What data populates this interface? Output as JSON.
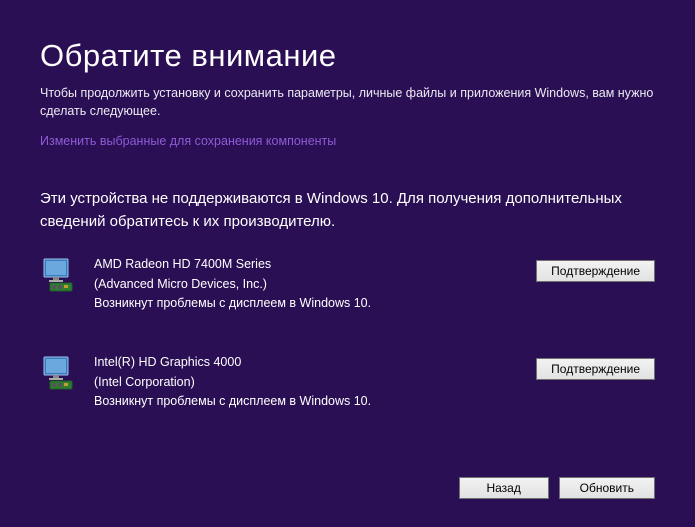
{
  "title": "Обратите внимание",
  "subtitle": "Чтобы продолжить установку и сохранить параметры, личные файлы и приложения Windows, вам нужно сделать следующее.",
  "change_link": "Изменить выбранные для сохранения компоненты",
  "section_heading": "Эти устройства не поддерживаются в Windows 10. Для получения дополнительных сведений обратитесь к их производителю.",
  "devices": [
    {
      "name": "AMD Radeon HD 7400M Series",
      "vendor": "(Advanced Micro Devices, Inc.)",
      "issue": "Возникнут проблемы с дисплеем в Windows 10.",
      "confirm_label": "Подтверждение"
    },
    {
      "name": "Intel(R) HD Graphics 4000",
      "vendor": "(Intel Corporation)",
      "issue": "Возникнут проблемы с дисплеем в Windows 10.",
      "confirm_label": "Подтверждение"
    }
  ],
  "footer": {
    "back_label": "Назад",
    "update_label": "Обновить"
  }
}
